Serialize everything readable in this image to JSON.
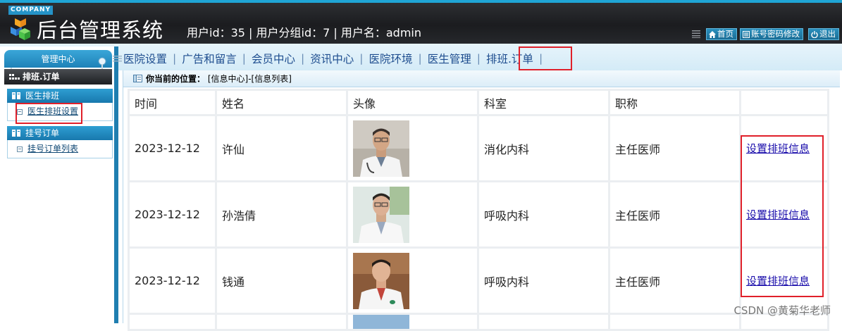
{
  "header": {
    "company": "COMPANY",
    "title": "后台管理系统",
    "user_info": "用户id：35 | 用户分组id：7 | 用户名：admin",
    "buttons": {
      "home": "首页",
      "password": "账号密码修改",
      "logout": "退出"
    }
  },
  "sidebar": {
    "tab": "管理中心",
    "section": "排班.订单",
    "groups": [
      {
        "title": "医生排班",
        "items": [
          "医生排班设置"
        ]
      },
      {
        "title": "挂号订单",
        "items": [
          "挂号订单列表"
        ]
      }
    ]
  },
  "nav": {
    "items": [
      "医院设置",
      "广告和留言",
      "会员中心",
      "资讯中心",
      "医院环境",
      "医生管理",
      "排班.订单"
    ],
    "separator": "|"
  },
  "breadcrumb": {
    "label": "你当前的位置：",
    "path": "[信息中心]-[信息列表]"
  },
  "table": {
    "headers": [
      "时间",
      "姓名",
      "头像",
      "科室",
      "职称",
      ""
    ],
    "action_label": "设置排班信息",
    "rows": [
      {
        "date": "2023-12-12",
        "name": "许仙",
        "dept": "消化内科",
        "title": "主任医师"
      },
      {
        "date": "2023-12-12",
        "name": "孙浩倩",
        "dept": "呼吸内科",
        "title": "主任医师"
      },
      {
        "date": "2023-12-12",
        "name": "钱通",
        "dept": "呼吸内科",
        "title": "主任医师"
      }
    ]
  },
  "watermark": "CSDN @黄菊华老师",
  "colors": {
    "header_dark": "#1b1c1f",
    "accent_blue": "#1f7eb0",
    "highlight_red": "#e0202a",
    "link": "#1a0dab"
  }
}
